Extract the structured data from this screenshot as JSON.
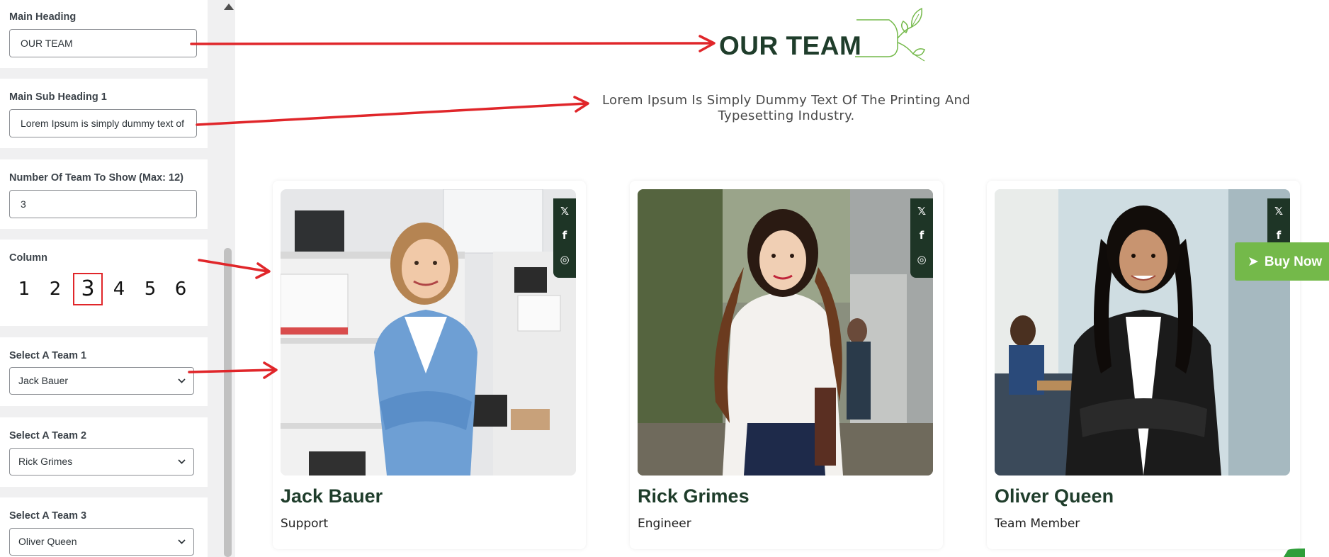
{
  "panel": {
    "main_heading": {
      "label": "Main Heading",
      "value": "OUR TEAM"
    },
    "main_subheading": {
      "label": "Main Sub Heading 1",
      "value": "Lorem Ipsum is simply dummy text of"
    },
    "team_count": {
      "label": "Number Of Team To Show (Max: 12)",
      "value": "3"
    },
    "column": {
      "label": "Column",
      "options": [
        "1",
        "2",
        "3",
        "4",
        "5",
        "6"
      ],
      "selected": "3"
    },
    "team_selects": [
      {
        "label": "Select A Team 1",
        "value": "Jack Bauer"
      },
      {
        "label": "Select A Team 2",
        "value": "Rick Grimes"
      },
      {
        "label": "Select A Team 3",
        "value": "Oliver Queen"
      }
    ]
  },
  "preview": {
    "heading": "OUR TEAM",
    "subheading": "Lorem Ipsum Is Simply Dummy Text Of The Printing And Typesetting Industry.",
    "members": [
      {
        "name": "Jack Bauer",
        "role": "Support"
      },
      {
        "name": "Rick Grimes",
        "role": "Engineer"
      },
      {
        "name": "Oliver Queen",
        "role": "Team Member"
      }
    ],
    "social_icons": [
      "x-icon",
      "facebook-icon",
      "instagram-icon"
    ]
  },
  "buy_now": {
    "label": "Buy Now"
  },
  "colors": {
    "heading_green": "#1f3d2b",
    "accent_green": "#74b94a",
    "annotation_red": "#e0262a"
  }
}
